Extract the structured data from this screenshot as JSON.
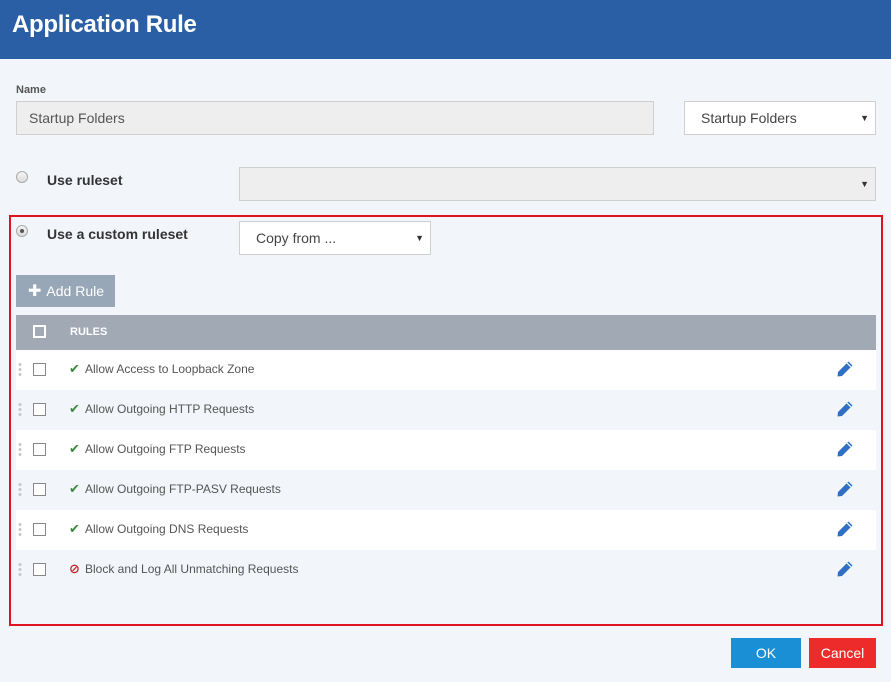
{
  "dialog": {
    "title": "Application Rule"
  },
  "name_section": {
    "label": "Name",
    "value": "Startup Folders",
    "select_value": "Startup Folders"
  },
  "use_ruleset": {
    "label": "Use ruleset",
    "checked": false,
    "select_value": ""
  },
  "custom_ruleset": {
    "label": "Use a custom ruleset",
    "checked": true,
    "copy_from": "Copy from ..."
  },
  "toolbar": {
    "add_rule_label": "Add Rule"
  },
  "rules": {
    "header": "RULES",
    "items": [
      {
        "name": "Allow Access to Loopback Zone",
        "status": "allow"
      },
      {
        "name": "Allow Outgoing HTTP Requests",
        "status": "allow"
      },
      {
        "name": "Allow Outgoing FTP Requests",
        "status": "allow"
      },
      {
        "name": "Allow Outgoing FTP-PASV Requests",
        "status": "allow"
      },
      {
        "name": "Allow Outgoing DNS Requests",
        "status": "allow"
      },
      {
        "name": "Block and Log All Unmatching Requests",
        "status": "block"
      }
    ]
  },
  "footer": {
    "ok_label": "OK",
    "cancel_label": "Cancel"
  },
  "colors": {
    "header": "#2a5fa6",
    "allow": "#3a8a3f",
    "block": "#c0282a",
    "ok": "#1b8fd6",
    "cancel": "#ee2b2b",
    "highlight": "#e0141e"
  },
  "icons": {
    "allow": "checkmark-icon",
    "block": "blocked-icon",
    "edit": "pencil-icon",
    "add": "plus-icon",
    "dropdown": "caret-down-icon"
  }
}
